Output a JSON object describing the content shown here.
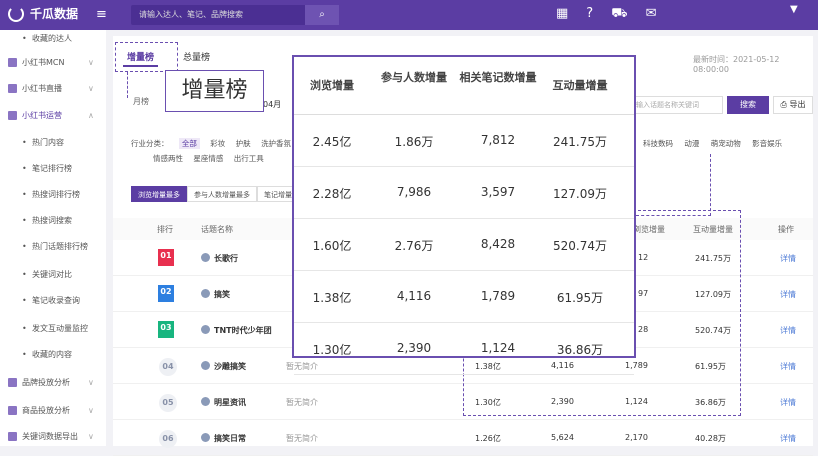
{
  "topbar": {
    "brand": "千瓜数据",
    "menu_icon": "≡",
    "search_placeholder": "请输入达人、笔记、品牌搜索",
    "search_icon": "⌕",
    "icons": [
      "grid-icon",
      "help-icon",
      "cart-icon",
      "mail-icon"
    ],
    "caret": "▼"
  },
  "sidebar": {
    "items": [
      {
        "type": "sub",
        "label": "收藏的达人"
      },
      {
        "type": "group",
        "label": "小红书MCN"
      },
      {
        "type": "group",
        "label": "小红书直播"
      },
      {
        "type": "group",
        "label": "小红书运营",
        "active": true
      },
      {
        "type": "sub",
        "label": "热门内容"
      },
      {
        "type": "sub",
        "label": "笔记排行榜"
      },
      {
        "type": "sub",
        "label": "热搜词排行榜"
      },
      {
        "type": "sub",
        "label": "热搜词搜索"
      },
      {
        "type": "sub",
        "label": "热门话题排行榜"
      },
      {
        "type": "sub",
        "label": "关键词对比"
      },
      {
        "type": "sub",
        "label": "笔记收录查询"
      },
      {
        "type": "sub",
        "label": "发文互动量监控"
      },
      {
        "type": "sub",
        "label": "收藏的内容"
      },
      {
        "type": "group",
        "label": "品牌投放分析"
      },
      {
        "type": "group",
        "label": "商品投放分析"
      },
      {
        "type": "group",
        "label": "关键词数据导出"
      }
    ]
  },
  "main": {
    "tab_growth": "增量榜",
    "tab_total": "总量榜",
    "timestamp": "最新时间：2021-05-12 08:00:00",
    "period_select": "月榜",
    "month": "04月",
    "keyword_placeholder": "输入话题名称关键词",
    "search_button": "搜索",
    "export_button": "导出",
    "category_label": "行业分类：",
    "categories_row1": [
      "全部",
      "彩妆",
      "护肤",
      "洗护香氛"
    ],
    "categories_row2": [
      "情感两性",
      "星座情感",
      "出行工具"
    ],
    "categories_right": [
      "科技数码",
      "动漫",
      "萌宠动物",
      "影音娱乐"
    ],
    "sort_tabs": [
      "浏览增量最多",
      "参与人数增量最多",
      "笔记增量"
    ],
    "headers": {
      "rank": "排行",
      "topic": "话题名称",
      "views": "浏览增量",
      "engagement": "互动量增量",
      "action": "操作"
    },
    "rows": [
      {
        "rank": "01",
        "name": "长歌行",
        "desc": "",
        "views_short": "12",
        "engagement": "241.75万",
        "detail": "详情"
      },
      {
        "rank": "02",
        "name": "搞笑",
        "desc": "",
        "views_short": "97",
        "engagement": "127.09万",
        "detail": "详情"
      },
      {
        "rank": "03",
        "name": "TNT时代少年团",
        "desc": "",
        "views_short": "28",
        "engagement": "520.74万",
        "detail": "详情"
      },
      {
        "rank": "04",
        "name": "沙雕搞笑",
        "desc": "暂无简介",
        "views": "1.38亿",
        "participants": "4,116",
        "notes": "1,789",
        "engagement": "61.95万",
        "detail": "详情"
      },
      {
        "rank": "05",
        "name": "明星资讯",
        "desc": "暂无简介",
        "views": "1.30亿",
        "participants": "2,390",
        "notes": "1,124",
        "engagement": "36.86万",
        "detail": "详情"
      },
      {
        "rank": "06",
        "name": "搞笑日常",
        "desc": "暂无简介",
        "views": "1.26亿",
        "participants": "5,624",
        "notes": "2,170",
        "engagement": "40.28万",
        "detail": "详情"
      }
    ],
    "rank_colors": [
      "#e8304f",
      "#2d7fe0",
      "#18b57f"
    ]
  },
  "overlay_label": "增量榜",
  "overlay_table": {
    "headers": [
      "浏览增量",
      "参与人数增量",
      "相关笔记数增量",
      "互动量增量"
    ],
    "rows": [
      [
        "2.45亿",
        "1.86万",
        "7,812",
        "241.75万"
      ],
      [
        "2.28亿",
        "7,986",
        "3,597",
        "127.09万"
      ],
      [
        "1.60亿",
        "2.76万",
        "8,428",
        "520.74万"
      ],
      [
        "1.38亿",
        "4,116",
        "1,789",
        "61.95万"
      ],
      [
        "1.30亿",
        "2,390",
        "1,124",
        "36.86万"
      ]
    ]
  }
}
